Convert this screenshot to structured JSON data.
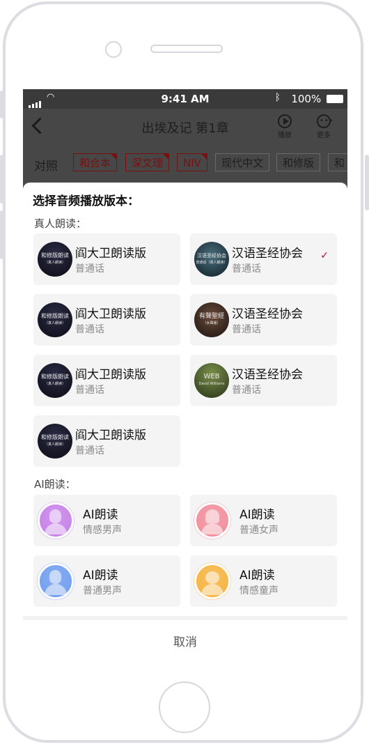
{
  "status_bar": {
    "time": "9:41 AM",
    "battery": "100%"
  },
  "nav": {
    "title": "出埃及记  第1章",
    "play_label": "播放",
    "more_label": "更多"
  },
  "tabs": {
    "compare_label": "对照",
    "versions": [
      {
        "label": "和合本",
        "selected": true
      },
      {
        "label": "深文理",
        "selected": true
      },
      {
        "label": "NIV",
        "selected": true
      },
      {
        "label": "现代中文",
        "selected": false
      },
      {
        "label": "和修版",
        "selected": false
      },
      {
        "label": "和",
        "selected": false
      }
    ]
  },
  "sheet": {
    "title": "选择音频播放版本：",
    "human_section_label": "真人朗读：",
    "human_items": [
      {
        "title": "阎大卫朗读版",
        "subtitle": "普通话",
        "avatar_text": "和修版朗读",
        "avatar_small": "（真人朗读）",
        "selected": false
      },
      {
        "title": "汉语圣经协会",
        "subtitle": "普通话",
        "avatar_text": "汉语圣经协会",
        "avatar_small": "普通话（真人朗读）",
        "selected": true
      },
      {
        "title": "阎大卫朗读版",
        "subtitle": "普通话",
        "avatar_text": "和修版朗读",
        "avatar_small": "（真人朗读）",
        "selected": false
      },
      {
        "title": "汉语圣经协会",
        "subtitle": "普通话",
        "avatar_text": "有聲聖經",
        "avatar_small": "（女聲版）",
        "selected": false
      },
      {
        "title": "阎大卫朗读版",
        "subtitle": "普通话",
        "avatar_text": "和修版朗读",
        "avatar_small": "（真人朗读）",
        "selected": false
      },
      {
        "title": "汉语圣经协会",
        "subtitle": "普通话",
        "avatar_text": "WEB",
        "avatar_small": "David Williams",
        "selected": false
      },
      {
        "title": "阎大卫朗读版",
        "subtitle": "普通话",
        "avatar_text": "和修版朗读",
        "avatar_small": "（真人朗读）",
        "selected": false
      }
    ],
    "ai_section_label": "AI朗读：",
    "ai_items": [
      {
        "title": "AI朗读",
        "subtitle": "情感男声",
        "color": "#c77ee8"
      },
      {
        "title": "AI朗读",
        "subtitle": "普通女声",
        "color": "#f28c9a"
      },
      {
        "title": "AI朗读",
        "subtitle": "普通男声",
        "color": "#6d9cf0"
      },
      {
        "title": "AI朗读",
        "subtitle": "情感童声",
        "color": "#f7b23b"
      }
    ],
    "cancel_label": "取消",
    "check_icon": "checkmark-icon"
  },
  "colors": {
    "accent": "#d0021b",
    "overlay": "#4a4a4a"
  }
}
